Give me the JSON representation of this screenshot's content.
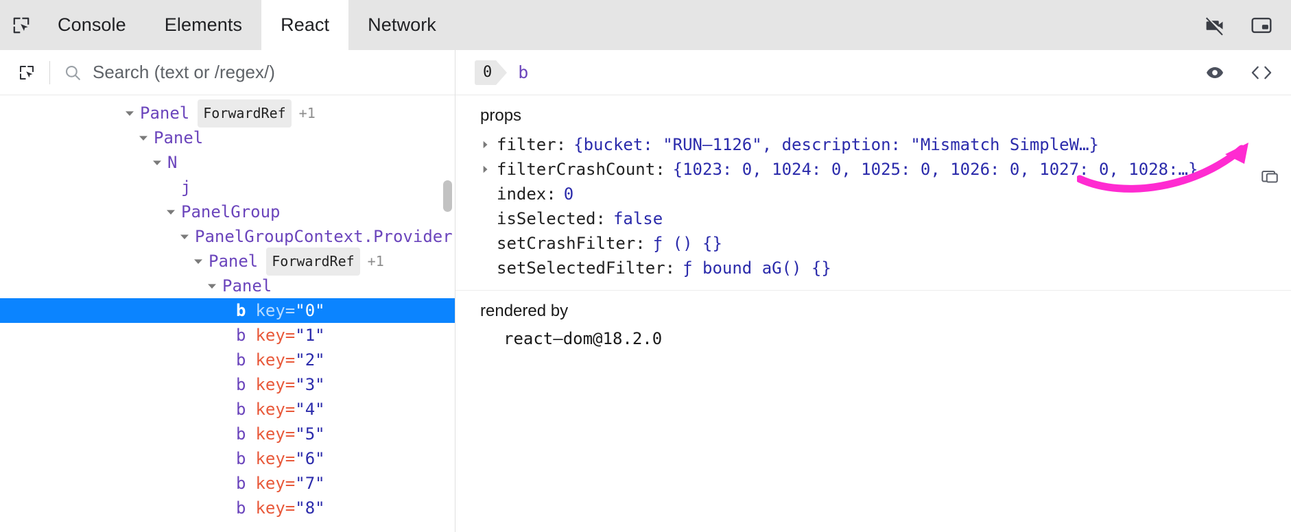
{
  "tabbar": {
    "inspect_tool_icon": "inspect-cursor-icon",
    "tabs": [
      {
        "label": "Console",
        "active": false
      },
      {
        "label": "Elements",
        "active": false
      },
      {
        "label": "React",
        "active": true
      },
      {
        "label": "Network",
        "active": false
      }
    ],
    "right_icons": [
      {
        "name": "video-camera-off-icon"
      },
      {
        "name": "picture-in-picture-icon"
      }
    ]
  },
  "search": {
    "select_element_icon": "select-element-icon",
    "search_icon": "search-icon",
    "placeholder": "Search (text or /regex/)",
    "value": ""
  },
  "tree": {
    "rows": [
      {
        "indent": 1,
        "arrow": "down",
        "name": "Panel",
        "hoc": "ForwardRef",
        "plus": "+1",
        "attr_key": "",
        "attr_val": "",
        "selected": false
      },
      {
        "indent": 2,
        "arrow": "down",
        "name": "Panel",
        "hoc": "",
        "plus": "",
        "attr_key": "",
        "attr_val": "",
        "selected": false
      },
      {
        "indent": 3,
        "arrow": "down",
        "name": "N",
        "hoc": "",
        "plus": "",
        "attr_key": "",
        "attr_val": "",
        "selected": false
      },
      {
        "indent": 4,
        "arrow": "none",
        "name": "j",
        "hoc": "",
        "plus": "",
        "attr_key": "",
        "attr_val": "",
        "selected": false
      },
      {
        "indent": 4,
        "arrow": "down",
        "name": "PanelGroup",
        "hoc": "",
        "plus": "",
        "attr_key": "",
        "attr_val": "",
        "selected": false
      },
      {
        "indent": 5,
        "arrow": "down",
        "name": "PanelGroupContext.Provider",
        "hoc": "",
        "plus": "",
        "attr_key": "",
        "attr_val": "",
        "selected": false
      },
      {
        "indent": 6,
        "arrow": "down",
        "name": "Panel",
        "hoc": "ForwardRef",
        "plus": "+1",
        "attr_key": "",
        "attr_val": "",
        "selected": false
      },
      {
        "indent": 7,
        "arrow": "down",
        "name": "Panel",
        "hoc": "",
        "plus": "",
        "attr_key": "",
        "attr_val": "",
        "selected": false
      },
      {
        "indent": 8,
        "arrow": "none",
        "name": "b",
        "hoc": "",
        "plus": "",
        "attr_key": "key=",
        "attr_val": "\"0\"",
        "selected": true
      },
      {
        "indent": 8,
        "arrow": "none",
        "name": "b",
        "hoc": "",
        "plus": "",
        "attr_key": "key=",
        "attr_val": "\"1\"",
        "selected": false
      },
      {
        "indent": 8,
        "arrow": "none",
        "name": "b",
        "hoc": "",
        "plus": "",
        "attr_key": "key=",
        "attr_val": "\"2\"",
        "selected": false
      },
      {
        "indent": 8,
        "arrow": "none",
        "name": "b",
        "hoc": "",
        "plus": "",
        "attr_key": "key=",
        "attr_val": "\"3\"",
        "selected": false
      },
      {
        "indent": 8,
        "arrow": "none",
        "name": "b",
        "hoc": "",
        "plus": "",
        "attr_key": "key=",
        "attr_val": "\"4\"",
        "selected": false
      },
      {
        "indent": 8,
        "arrow": "none",
        "name": "b",
        "hoc": "",
        "plus": "",
        "attr_key": "key=",
        "attr_val": "\"5\"",
        "selected": false
      },
      {
        "indent": 8,
        "arrow": "none",
        "name": "b",
        "hoc": "",
        "plus": "",
        "attr_key": "key=",
        "attr_val": "\"6\"",
        "selected": false
      },
      {
        "indent": 8,
        "arrow": "none",
        "name": "b",
        "hoc": "",
        "plus": "",
        "attr_key": "key=",
        "attr_val": "\"7\"",
        "selected": false
      },
      {
        "indent": 8,
        "arrow": "none",
        "name": "b",
        "hoc": "",
        "plus": "",
        "attr_key": "key=",
        "attr_val": "\"8\"",
        "selected": false
      }
    ]
  },
  "inspector": {
    "index_badge": "0",
    "selected_component": "b",
    "right_icons": [
      {
        "name": "eye-icon"
      },
      {
        "name": "code-brackets-icon"
      }
    ],
    "props_title": "props",
    "props": [
      {
        "expandable": true,
        "name": "filter",
        "value": "{bucket: \"RUN–1126\", description: \"Mismatch SimpleW…}",
        "kind": "object"
      },
      {
        "expandable": true,
        "name": "filterCrashCount",
        "value": "{1023: 0, 1024: 0, 1025: 0, 1026: 0, 1027: 0, 1028:…}",
        "kind": "object"
      },
      {
        "expandable": false,
        "name": "index",
        "value": "0",
        "kind": "number"
      },
      {
        "expandable": false,
        "name": "isSelected",
        "value": "false",
        "kind": "boolean"
      },
      {
        "expandable": false,
        "name": "setCrashFilter",
        "value": "ƒ () {}",
        "kind": "function"
      },
      {
        "expandable": false,
        "name": "setSelectedFilter",
        "value": "ƒ bound aG() {}",
        "kind": "function"
      }
    ],
    "rendered_by_title": "rendered by",
    "rendered_by": [
      "react–dom@18.2.0"
    ]
  },
  "annotation": {
    "arrow_color": "#ff2bd1",
    "corner_icon": "dock-window-icon"
  },
  "colors": {
    "selection_blue": "#0b84ff",
    "component_purple": "#6b45bc",
    "attr_key_orange": "#e8593a",
    "attr_value_blue": "#2b2bab",
    "tabbar_gray": "#e5e5e5"
  }
}
